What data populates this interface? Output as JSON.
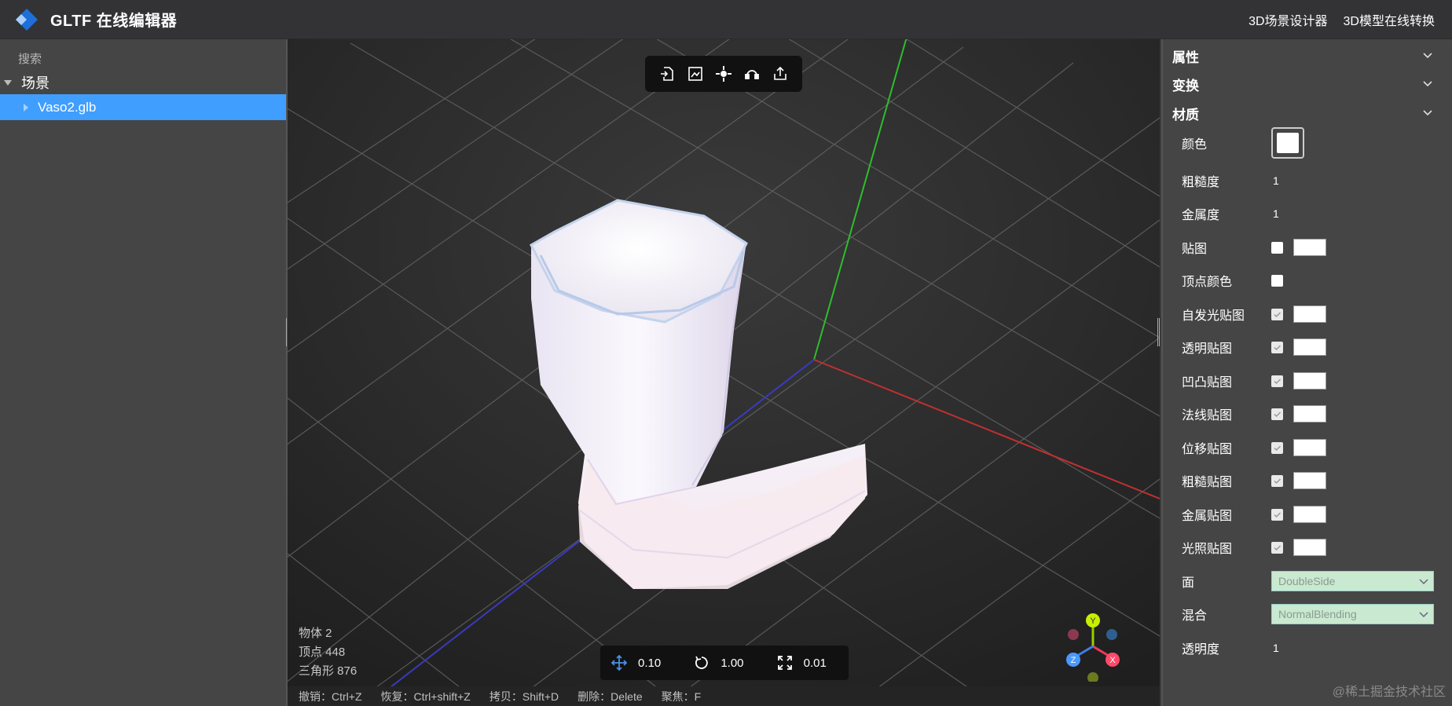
{
  "header": {
    "title": "GLTF 在线编辑器",
    "links": [
      "3D场景设计器",
      "3D模型在线转换"
    ]
  },
  "left_panel": {
    "search_label": "搜索",
    "tree_root": "场景",
    "tree_item": "Vaso2.glb"
  },
  "viewport": {
    "stats": {
      "objects": "物体 2",
      "vertices": "顶点 448",
      "triangles": "三角形 876"
    },
    "controls": {
      "translate_snap": "0.10",
      "rotate_snap": "1.00",
      "scale_snap": "0.01"
    },
    "shortcuts": [
      "撤销：Ctrl+Z",
      "恢复：Ctrl+shift+Z",
      "拷贝：Shift+D",
      "删除：Delete",
      "聚焦：F"
    ],
    "gizmo_axes": {
      "x": "X",
      "y": "Y",
      "z": "Z"
    }
  },
  "right_panel": {
    "sections": {
      "properties": "属性",
      "transform": "变换",
      "material": "材质"
    },
    "material": {
      "color_label": "颜色",
      "roughness_label": "粗糙度",
      "roughness_value": "1",
      "metalness_label": "金属度",
      "metalness_value": "1",
      "map_label": "贴图",
      "vertex_colors_label": "顶点颜色",
      "emissive_map_label": "自发光贴图",
      "alpha_map_label": "透明贴图",
      "bump_map_label": "凹凸贴图",
      "normal_map_label": "法线贴图",
      "displacement_map_label": "位移贴图",
      "roughness_map_label": "粗糙贴图",
      "metalness_map_label": "金属贴图",
      "light_map_label": "光照贴图",
      "side_label": "面",
      "side_value": "DoubleSide",
      "blending_label": "混合",
      "blending_value": "NormalBlending",
      "opacity_label": "透明度",
      "opacity_value": "1"
    }
  },
  "watermark": "@稀土掘金技术社区",
  "colors": {
    "accent": "#409eff",
    "panel_bg": "#454545",
    "viewport_bg": "#2a2a2a",
    "select_bg": "#c9e9d1"
  }
}
